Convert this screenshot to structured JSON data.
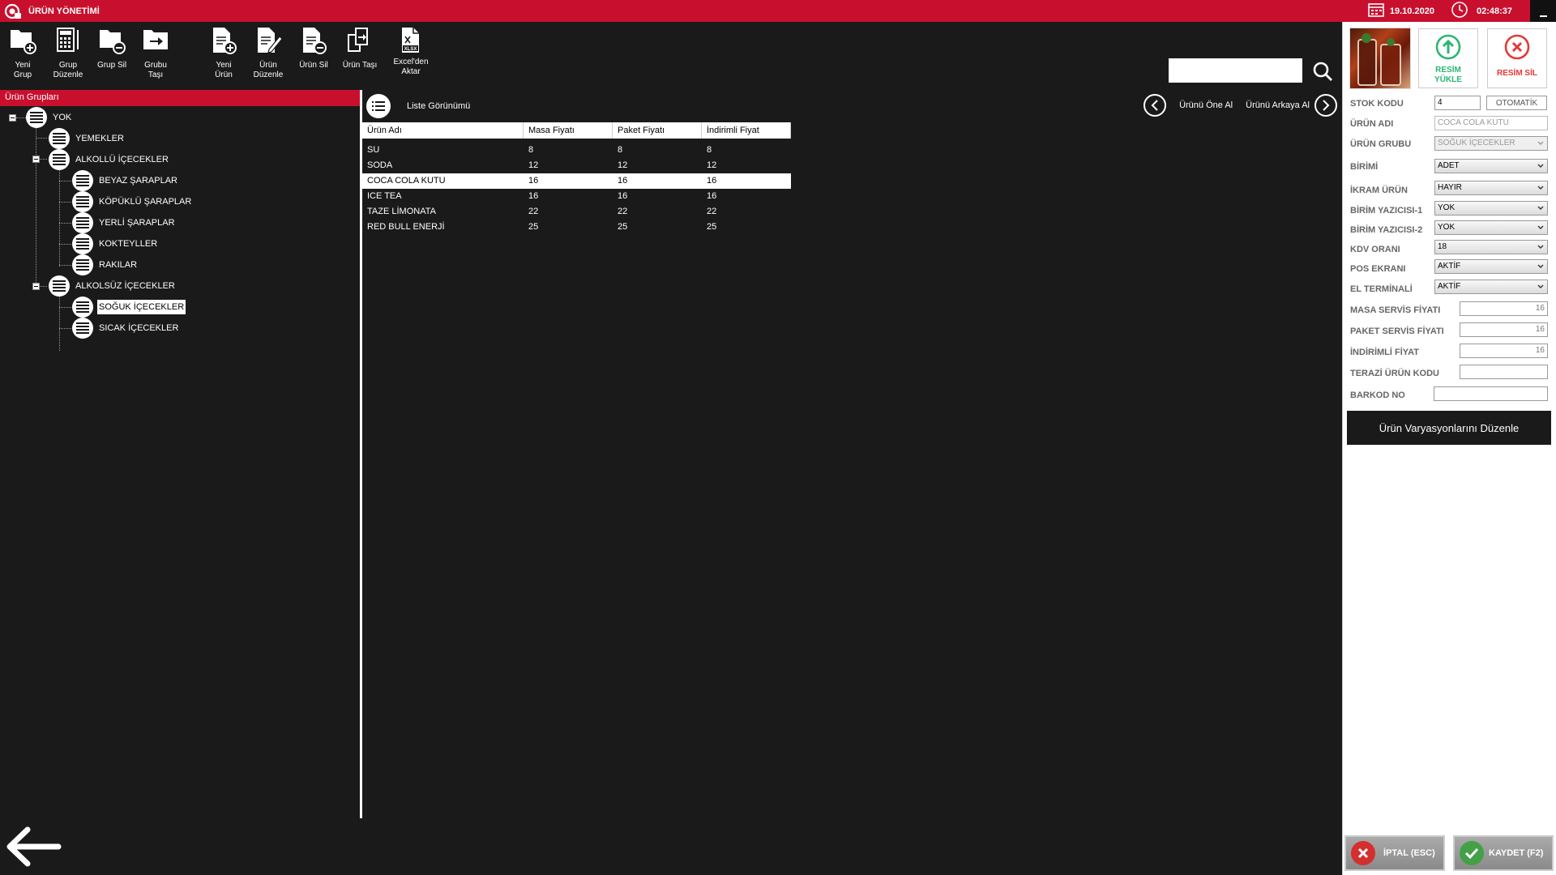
{
  "app": {
    "title": "ÜRÜN YÖNETİMİ",
    "date": "19.10.2020",
    "time": "02:48:37"
  },
  "toolbar": {
    "new_group": "Yeni\nGrup",
    "edit_group": "Grup\nDüzenle",
    "delete_group": "Grup Sil",
    "move_group": "Grubu\nTaşı",
    "new_product": "Yeni\nÜrün",
    "edit_product": "Ürün\nDüzenle",
    "delete_product": "Ürün Sil",
    "move_product": "Ürün Taşı",
    "excel_import": "Excel'den\nAktar",
    "search_value": ""
  },
  "groups": {
    "header": "Ürün Grupları",
    "root": "YOK",
    "yemekler": "YEMEKLER",
    "alkollu": "ALKOLLÜ İÇECEKLER",
    "beyaz": "BEYAZ ŞARAPLAR",
    "kopuklu": "KÖPÜKLÜ ŞARAPLAR",
    "yerli": "YERLİ ŞARAPLAR",
    "kokteyller": "KOKTEYLLER",
    "rakilar": "RAKILAR",
    "alkolsuz": "ALKOLSÜZ İÇECEKLER",
    "soguk": "SOĞUK İÇECEKLER",
    "sicak": "SICAK İÇECEKLER"
  },
  "list": {
    "view_label": "Liste Görünümü",
    "move_front": "Ürünü Öne Al",
    "move_back": "Ürünü Arkaya Al",
    "columns": [
      "Ürün Adı",
      "Masa Fiyatı",
      "Paket Fiyatı",
      "İndirimli Fiyat"
    ],
    "rows": [
      [
        "SU",
        "8",
        "8",
        "8"
      ],
      [
        "SODA",
        "12",
        "12",
        "12"
      ],
      [
        "COCA COLA KUTU",
        "16",
        "16",
        "16"
      ],
      [
        "ICE TEA",
        "16",
        "16",
        "16"
      ],
      [
        "TAZE LİMONATA",
        "22",
        "22",
        "22"
      ],
      [
        "RED BULL ENERJİ",
        "25",
        "25",
        "25"
      ]
    ],
    "selected_index": 2
  },
  "detail": {
    "upload_label": "RESİM\nYÜKLE",
    "remove_label": "RESİM SİL",
    "labels": {
      "stock_code": "STOK KODU",
      "product_name": "ÜRÜN ADI",
      "product_group": "ÜRÜN GRUBU",
      "unit": "BİRİMİ",
      "treat": "İKRAM ÜRÜN",
      "printer1": "BİRİM YAZICISI-1",
      "printer2": "BİRİM YAZICISI-2",
      "vat": "KDV ORANI",
      "pos": "POS EKRANI",
      "handheld": "EL TERMİNALİ",
      "table_price": "MASA SERVİS FİYATI",
      "package_price": "PAKET SERVİS FİYATI",
      "discount_price": "İNDİRİMLİ FİYAT",
      "scale_code": "TERAZİ ÜRÜN KODU",
      "barcode": "BARKOD NO"
    },
    "values": {
      "stock_code": "4",
      "auto_label": "OTOMATİK",
      "product_name": "COCA COLA KUTU",
      "product_group": "SOĞUK İÇECEKLER",
      "unit": "ADET",
      "treat": "HAYIR",
      "printer1": "YOK",
      "printer2": "YOK",
      "vat": "18",
      "pos": "AKTİF",
      "handheld": "AKTİF",
      "table_price": "16",
      "package_price": "16",
      "discount_price": "16",
      "scale_code": "",
      "barcode": ""
    },
    "variations_button": "Ürün Varyasyonlarını Düzenle",
    "cancel_button": "İPTAL (ESC)",
    "save_button": "KAYDET (F2)"
  },
  "colors": {
    "brand": "#c8102e",
    "dark": "#1a1a1a",
    "cancel": "#d32f2f",
    "save": "#43a047",
    "upload": "#2bb673",
    "remove": "#e53935"
  }
}
